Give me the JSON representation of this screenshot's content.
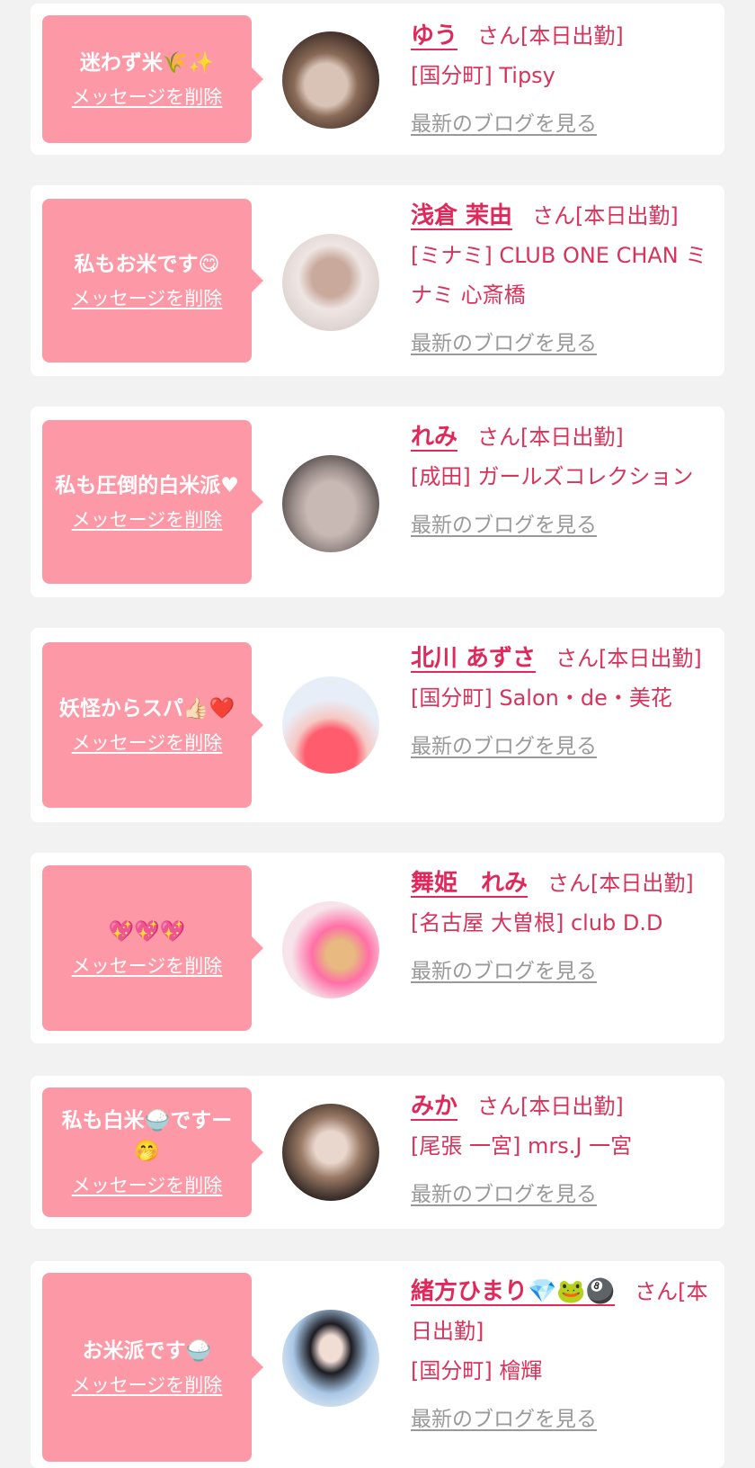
{
  "entries": [
    {
      "message": "迷わず米🌾✨",
      "delete_label": "メッセージを削除",
      "name": "ゆう",
      "suffix": "さん[本日出勤]",
      "shop": "[国分町] Tipsy",
      "blog_label": "最新のブログを見る",
      "avatar_colors": [
        "#3a2a24",
        "#8a6b58",
        "#d8c3b6"
      ]
    },
    {
      "message": "私もお米です😋",
      "delete_label": "メッセージを削除",
      "name": "浅倉 茉由",
      "suffix": "さん[本日出勤]",
      "shop": "[ミナミ] CLUB ONE CHAN ミナミ 心斎橋",
      "blog_label": "最新のブログを見る",
      "avatar_colors": [
        "#efe6e4",
        "#c8a99c",
        "#6d4c40"
      ]
    },
    {
      "message": "私も圧倒的白米派♥",
      "delete_label": "メッセージを削除",
      "name": "れみ",
      "suffix": "さん[本日出勤]",
      "shop": "[成田] ガールズコレクション",
      "blog_label": "最新のブログを見る",
      "avatar_colors": [
        "#7b7471",
        "#c9b9b5",
        "#3a3535"
      ]
    },
    {
      "message": "妖怪からスパ👍🏻❤️",
      "delete_label": "メッセージを削除",
      "name": "北川 あずさ",
      "suffix": "さん[本日出勤]",
      "shop": "[国分町] Salon・de・美花",
      "blog_label": "最新のブログを見る",
      "avatar_colors": [
        "#e8eef7",
        "#ff5c6e",
        "#2a2222"
      ]
    },
    {
      "message": "💖💖💖",
      "delete_label": "メッセージを削除",
      "name": "舞姫　れみ",
      "suffix": "さん[本日出勤]",
      "shop": "[名古屋 大曽根] club D.D",
      "blog_label": "最新のブログを見る",
      "avatar_colors": [
        "#f6e4ea",
        "#ff6fa6",
        "#e8b980"
      ]
    },
    {
      "message": "私も白米🍚ですー🤭",
      "delete_label": "メッセージを削除",
      "name": "みか",
      "suffix": "さん[本日出勤]",
      "shop": "[尾張 一宮] mrs.J 一宮",
      "blog_label": "最新のブログを見る",
      "avatar_colors": [
        "#2e2420",
        "#9a7a66",
        "#e9d6cc"
      ]
    },
    {
      "message": "お米派です🍚",
      "delete_label": "メッセージを削除",
      "name": "緒方ひまり💎🐸🎱",
      "suffix": "さん[本日出勤]",
      "shop": "[国分町] 檜輝",
      "blog_label": "最新のブログを見る",
      "avatar_colors": [
        "#dfe9f2",
        "#1c1c22",
        "#a9c7e6"
      ]
    }
  ]
}
